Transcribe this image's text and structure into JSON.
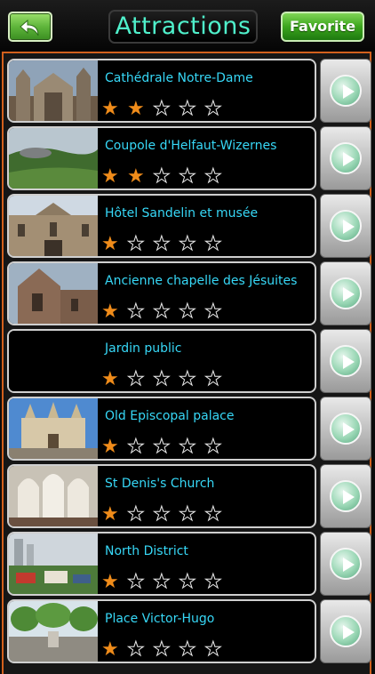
{
  "header": {
    "title": "Attractions",
    "favorite_label": "Favorite"
  },
  "colors": {
    "accent_frame": "#d2601d",
    "title_text": "#4ff0cb",
    "item_text": "#37d8f7",
    "star_filled": "#f08c1a",
    "button_green": "#3ca51d"
  },
  "icons": {
    "back": "back-arrow-icon",
    "star_filled": "star-filled-icon",
    "star_empty": "star-empty-icon",
    "go": "play-arrow-icon"
  },
  "items": [
    {
      "name": "Cathédrale Notre-Dame",
      "rating": 2,
      "rating_max": 5
    },
    {
      "name": "Coupole d'Helfaut-Wizernes",
      "rating": 2,
      "rating_max": 5
    },
    {
      "name": "Hôtel Sandelin et musée",
      "rating": 1,
      "rating_max": 5
    },
    {
      "name": "Ancienne chapelle des Jésuites",
      "rating": 1,
      "rating_max": 5
    },
    {
      "name": "Jardin public",
      "rating": 1,
      "rating_max": 5
    },
    {
      "name": "Old Episcopal palace",
      "rating": 1,
      "rating_max": 5
    },
    {
      "name": "St Denis's Church",
      "rating": 1,
      "rating_max": 5
    },
    {
      "name": "North District",
      "rating": 1,
      "rating_max": 5
    },
    {
      "name": "Place Victor-Hugo",
      "rating": 1,
      "rating_max": 5
    }
  ]
}
